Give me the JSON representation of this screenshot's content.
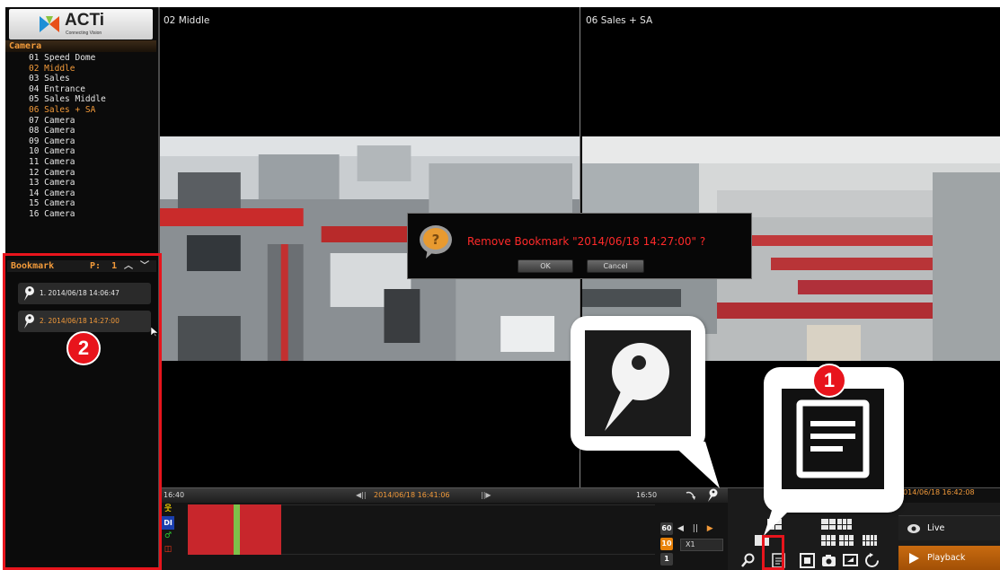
{
  "logo": {
    "brand": "ACTi",
    "tagline": "Connecting Vision"
  },
  "camera": {
    "header": "Camera",
    "items": [
      {
        "label": "01 Speed Dome",
        "active": false
      },
      {
        "label": "02 Middle",
        "active": true
      },
      {
        "label": "03 Sales",
        "active": false
      },
      {
        "label": "04 Entrance",
        "active": false
      },
      {
        "label": "05 Sales Middle",
        "active": false
      },
      {
        "label": "06 Sales + SA",
        "active": true
      },
      {
        "label": "07 Camera",
        "active": false
      },
      {
        "label": "08 Camera",
        "active": false
      },
      {
        "label": "09 Camera",
        "active": false
      },
      {
        "label": "10 Camera",
        "active": false
      },
      {
        "label": "11 Camera",
        "active": false
      },
      {
        "label": "12 Camera",
        "active": false
      },
      {
        "label": "13 Camera",
        "active": false
      },
      {
        "label": "14 Camera",
        "active": false
      },
      {
        "label": "15 Camera",
        "active": false
      },
      {
        "label": "16 Camera",
        "active": false
      }
    ]
  },
  "bookmark": {
    "header": "Bookmark",
    "page_label": "P:",
    "page": "1",
    "items": [
      {
        "label": "1. 2014/06/18 14:06:47"
      },
      {
        "label": "2. 2014/06/18 14:27:00"
      }
    ]
  },
  "panes": [
    {
      "title": "02 Middle"
    },
    {
      "title": "06 Sales + SA"
    }
  ],
  "dialog": {
    "message": "Remove Bookmark \"2014/06/18 14:27:00\" ?",
    "ok": "OK",
    "cancel": "Cancel"
  },
  "timeline": {
    "start": "16:40",
    "end": "16:50",
    "current": "2014/06/18 16:41:06",
    "prev": "◀||",
    "next": "||▶",
    "event_icons": {
      "motion": "motion-icon",
      "di": "DI",
      "do": "do-icon",
      "rec": "rec-icon"
    },
    "speeds": [
      "60",
      "10",
      "1"
    ],
    "selected_speed": "10",
    "rate": "X1",
    "controls": {
      "back": "◀",
      "pause": "||",
      "play": "▶"
    }
  },
  "control": {
    "datetime": "2014/06/18 16:42:08",
    "live": "Live",
    "playback": "Playback"
  },
  "callouts": {
    "badge_1": "1",
    "badge_2": "2"
  },
  "colors": {
    "accent": "#f29a3a",
    "alert": "#ff2a2a",
    "highlight": "#e8141c",
    "recording": "#c8262c"
  }
}
